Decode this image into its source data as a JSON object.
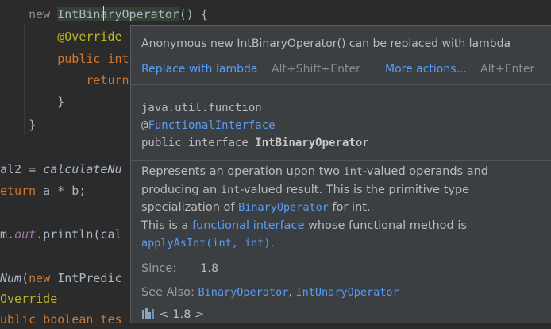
{
  "editor": {
    "line1": {
      "new_kw": "new",
      "type": "IntBinaryOperator",
      "rest": "() {"
    },
    "line2": {
      "annotation": "@Override"
    },
    "line3": {
      "kw": "public",
      "text": " int"
    },
    "line4": {
      "kw": "return"
    },
    "line5": {
      "text": "}"
    },
    "line6": {
      "text": "}"
    },
    "line8": {
      "prefix": "al2 = ",
      "method": "calculateNu"
    },
    "line9": {
      "kw": "eturn",
      "rest": " a * b;"
    },
    "line11": {
      "prefix": "m.",
      "field": "out",
      "rest": ".println(cal"
    },
    "line13": {
      "method": "Num",
      "rest": "(",
      "new_kw": "new",
      "tail": " IntPredic"
    },
    "line14": {
      "annotation": "Override"
    },
    "line15": {
      "text": "ublic boolean tes"
    }
  },
  "popup": {
    "intention": {
      "message": "Anonymous new IntBinaryOperator() can be replaced with lambda",
      "action_label": "Replace with lambda",
      "action_shortcut": "Alt+Shift+Enter",
      "more_label": "More actions...",
      "more_shortcut": "Alt+Enter"
    },
    "declaration": {
      "package": "java.util.function",
      "annotation_at": "@",
      "annotation_name": "FunctionalInterface",
      "modifiers": "public interface ",
      "name": "IntBinaryOperator"
    },
    "doc": {
      "p1_a": "Represents an operation upon two ",
      "p1_code1": "int",
      "p1_b": "-valued operands and producing an ",
      "p1_code2": "int",
      "p1_c": "-valued result. This is the primitive type specialization of ",
      "p1_link": "BinaryOperator",
      "p1_d": " for ",
      "p1_code3": "int",
      "p1_e": ".",
      "p2_a": "This is a ",
      "p2_link": "functional interface",
      "p2_b": " whose functional method is ",
      "p2_method": "applyAsInt(int, int)",
      "p2_c": "."
    },
    "since_label": "Since:",
    "since_value": "1.8",
    "see_also_label": "See Also:",
    "see_also_1": "BinaryOperator",
    "see_also_sep": ", ",
    "see_also_2": "IntUnaryOperator",
    "library_label": "< 1.8 >"
  },
  "colors": {
    "background": "#2b2b2b",
    "popup_bg": "#3c3f41",
    "link": "#589df6",
    "keyword": "#cc7832",
    "annotation": "#bbb529"
  }
}
